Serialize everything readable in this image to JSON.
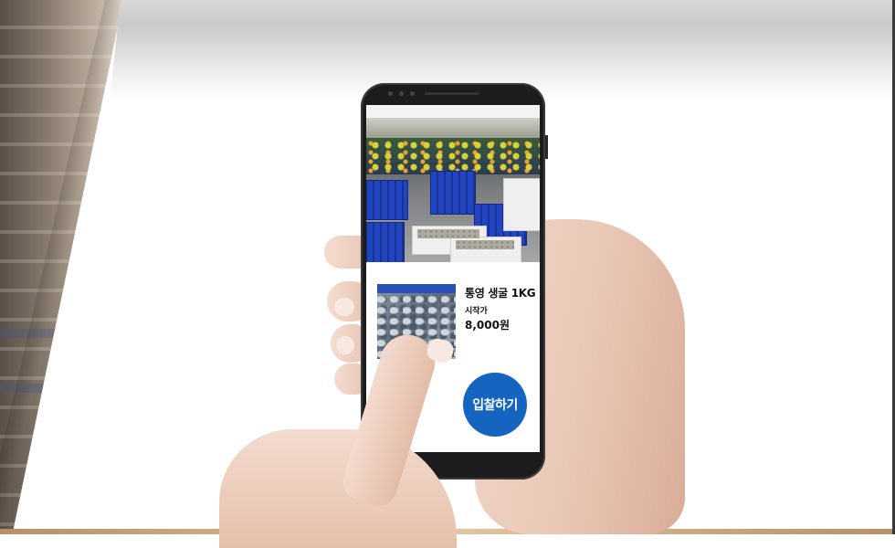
{
  "product": {
    "name": "통영 생굴 1KG",
    "start_label": "시작가",
    "start_price": "8,000원"
  },
  "actions": {
    "bid_label": "입찰하기"
  },
  "colors": {
    "bid_button": "#1565c0",
    "crates": "#1f3fb7"
  }
}
